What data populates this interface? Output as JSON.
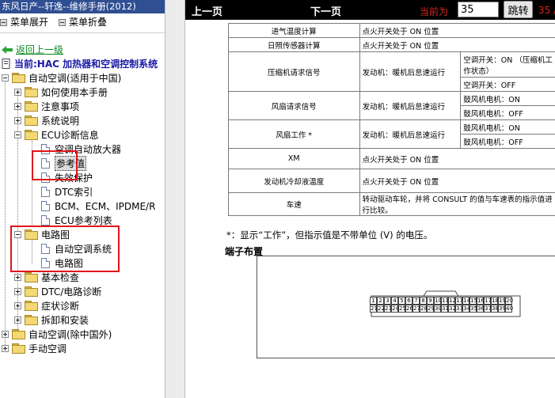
{
  "window": {
    "title": "东风日产--轩逸--维修手册(2012)"
  },
  "menu": {
    "expand": "菜单展开",
    "collapse": "菜单折叠"
  },
  "nav": {
    "back": "返回上一级",
    "current": "当前:HAC 加热器和空调控制系统"
  },
  "tree": [
    {
      "label": "自动空调(适用于中国)",
      "level": 0,
      "kind": "folder",
      "open": true
    },
    {
      "label": "如何使用本手册",
      "level": 1,
      "kind": "folder",
      "open": false
    },
    {
      "label": "注意事项",
      "level": 1,
      "kind": "folder",
      "open": false
    },
    {
      "label": "系统说明",
      "level": 1,
      "kind": "folder",
      "open": false
    },
    {
      "label": "ECU诊断信息",
      "level": 1,
      "kind": "folder",
      "open": true
    },
    {
      "label": "空调自动放大器",
      "level": 2,
      "kind": "doc"
    },
    {
      "label": "参考值",
      "level": 2,
      "kind": "doc",
      "selected": true
    },
    {
      "label": "失效保护",
      "level": 2,
      "kind": "doc"
    },
    {
      "label": "DTC索引",
      "level": 2,
      "kind": "doc"
    },
    {
      "label": "BCM、ECM、IPDME/R",
      "level": 2,
      "kind": "doc"
    },
    {
      "label": "ECU参考列表",
      "level": 2,
      "kind": "doc"
    },
    {
      "label": "电路图",
      "level": 1,
      "kind": "folder",
      "open": true
    },
    {
      "label": "自动空调系统",
      "level": 2,
      "kind": "doc"
    },
    {
      "label": "电路图",
      "level": 2,
      "kind": "doc"
    },
    {
      "label": "基本检查",
      "level": 1,
      "kind": "folder",
      "open": false
    },
    {
      "label": "DTC/电路诊断",
      "level": 1,
      "kind": "folder",
      "open": false
    },
    {
      "label": "症状诊断",
      "level": 1,
      "kind": "folder",
      "open": false
    },
    {
      "label": "拆卸和安装",
      "level": 1,
      "kind": "folder",
      "open": false
    },
    {
      "label": "自动空调(除中国外)",
      "level": 0,
      "kind": "folder",
      "open": false
    },
    {
      "label": "手动空调",
      "level": 0,
      "kind": "folder",
      "open": false
    }
  ],
  "toolbar": {
    "prev": "上一页",
    "next": "下一页",
    "current_label": "当前为",
    "page_value": "35",
    "jump": "跳转",
    "total": "35 /"
  },
  "table": {
    "rows": [
      {
        "item": "进气温度计算",
        "condition": "点火开关处于 ON 位置",
        "state": ""
      },
      {
        "item": "日照传感器计算",
        "condition": "点火开关处于 ON 位置",
        "state": ""
      },
      {
        "item": "压缩机请求信号",
        "condition": "发动机：暖机后怠速运行",
        "state": "空调开关：ON （压缩机工作状态）",
        "state2": "空调开关：OFF"
      },
      {
        "item": "风扇请求信号",
        "condition": "发动机：暖机后怠速运行",
        "state": "鼓风机电机：ON",
        "state2": "鼓风机电机：OFF"
      },
      {
        "item": "风扇工作 *",
        "condition": "发动机：暖机后怠速运行",
        "state": "鼓风机电机：ON",
        "state2": "鼓风机电机：OFF"
      },
      {
        "item": "XM",
        "condition": "点火开关处于 ON 位置",
        "state": ""
      },
      {
        "item": "发动机冷却液温度",
        "condition": "点火开关处于 ON 位置",
        "state": ""
      },
      {
        "item": "车速",
        "condition": "转动驱动车轮，并将 CONSULT 的值与车速表的指示值进行比较。",
        "state": ""
      }
    ]
  },
  "note": "*：显示“工作”，但指示值是不带单位 (V) 的电压。",
  "terminal_title": "端子布置",
  "connector": {
    "top_pins": [
      "1",
      "2",
      "3",
      "4",
      "5",
      "6",
      "7",
      "8",
      "9",
      "10",
      "11",
      "12",
      "13",
      "14",
      "15",
      "16",
      "17",
      "18",
      "19",
      "20"
    ],
    "bottom_pins": [
      "21",
      "22",
      "23",
      "24",
      "25",
      "26",
      "27",
      "28",
      "29",
      "30",
      "31",
      "32",
      "33",
      "34",
      "35",
      "36",
      "37",
      "38",
      "39",
      "40"
    ]
  },
  "colors": {
    "title_bar": "#2f4f92",
    "highlight_box": "#e0141a",
    "back_link": "#0a8a22",
    "current": "#1a1aa6",
    "toolbar_bg": "#000000",
    "toolbar_accent": "#d9261c"
  }
}
